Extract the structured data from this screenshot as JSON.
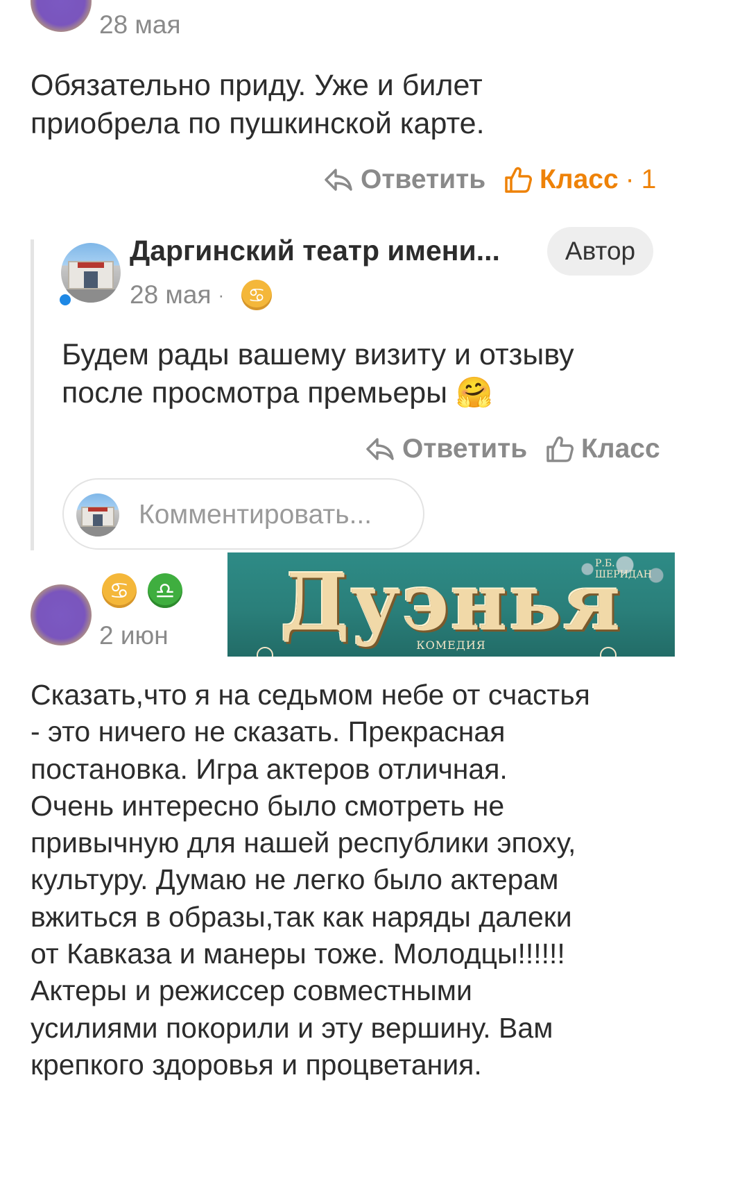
{
  "comment1": {
    "date": "28 мая",
    "text_lines": [
      "Обязательно приду. Уже и билет",
      "приобрела по пушкинской карте."
    ],
    "reply_label": "Ответить",
    "like_label": "Класс",
    "like_separator": "·",
    "like_count": "1"
  },
  "reply": {
    "author": "Даргинский театр имени...",
    "badge": "Автор",
    "date": "28 мая",
    "date_separator": "·",
    "text_lines": [
      "Будем рады вашему визиту и отзыву",
      "после просмотра премьеры 🤗"
    ],
    "reply_label": "Ответить",
    "like_label": "Класс",
    "comment_placeholder": "Комментировать..."
  },
  "comment2": {
    "date": "2 июн",
    "text_lines": [
      "Сказать,что я на седьмом небе от счастья",
      "- это ничего не сказать. Прекрасная",
      "постановка. Игра актеров отличная.",
      "Очень интересно было смотреть не",
      "привычную для нашей республики эпоху,",
      "культуру. Думаю не легко было актерам",
      "вжиться в образы,так как наряды далеки",
      "от Кавказа и манеры тоже. Молодцы!!!!!!",
      "Актеры и режиссер совместными",
      "усилиями покорили и эту вершину. Вам",
      "крепкого здоровья и процветания."
    ]
  },
  "banner": {
    "author": "Р.Б. ШЕРИДАН",
    "title": "Дуэнья",
    "genre": "КОМЕДИЯ"
  },
  "icons": {
    "cancer": "♋",
    "libra": "♎",
    "hug_emoji": "🤗"
  },
  "colors": {
    "accent_orange": "#ee8208",
    "muted_grey": "#8a8a8a",
    "online_blue": "#1e88e5"
  }
}
